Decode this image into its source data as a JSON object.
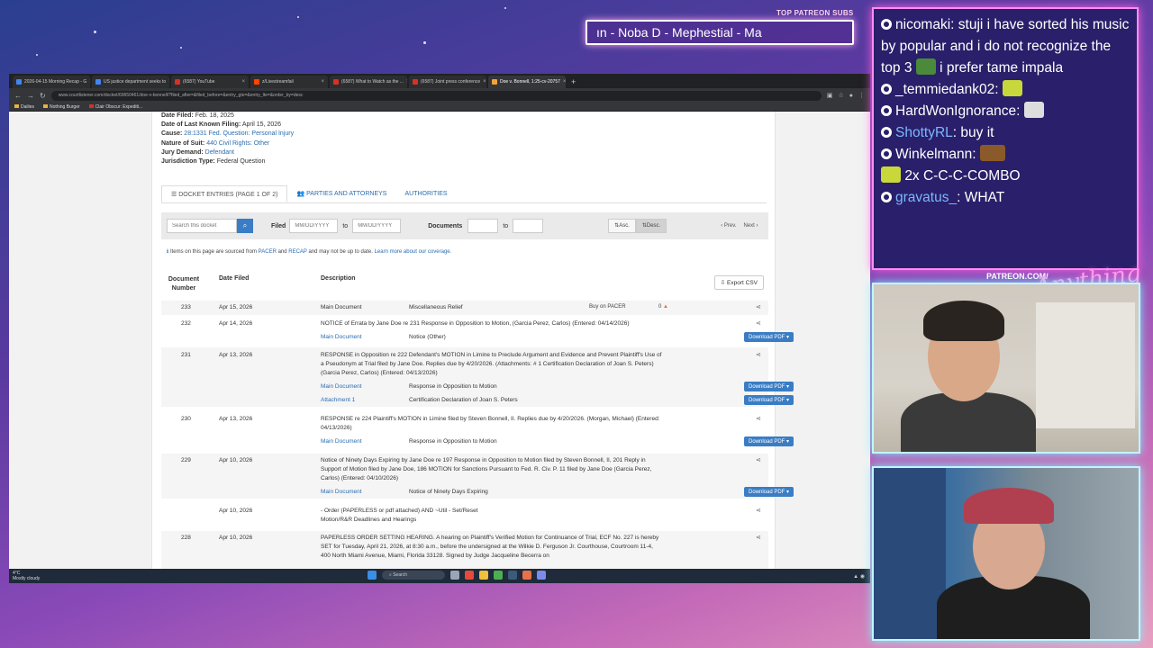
{
  "overlay": {
    "subs_title": "TOP PATREON SUBS",
    "subs_ticker": "ın -  Noba D - Mephestial - Ma",
    "patreon_url": "PATREON.COM/",
    "logo_text": "Anything Else?"
  },
  "browser": {
    "tabs": [
      {
        "label": "2026-04-15 Morning Recap - G"
      },
      {
        "label": "US justice department seeks to"
      },
      {
        "label": "(6587) YouTube"
      },
      {
        "label": "z/Livestreamfail"
      },
      {
        "label": "(6587) What to Watch as the ..."
      },
      {
        "label": "(6587) Joint press conference"
      },
      {
        "label": "Doe v. Bonnell, 1:25-cv-20757"
      }
    ],
    "url": "www.courtlistener.com/docket/69650461/doe-v-bonnell/?filed_after=&filed_before=&entry_gte=&entry_lte=&order_by=desc",
    "bookmarks": [
      "Dailies",
      "Nothing Burger",
      "Clair Obscur: Expediti..."
    ]
  },
  "case": {
    "date_filed_label": "Date Filed:",
    "date_filed": "Feb. 18, 2025",
    "last_filing_label": "Date of Last Known Filing:",
    "last_filing": "April 15, 2026",
    "cause_label": "Cause:",
    "cause": "28:1331 Fed. Question: Personal Injury",
    "nature_label": "Nature of Suit:",
    "nature": "440 Civil Rights: Other",
    "jury_label": "Jury Demand:",
    "jury": "Defendant",
    "jurisdiction_label": "Jurisdiction Type:",
    "jurisdiction": "Federal Question"
  },
  "subtabs": {
    "docket": "DOCKET ENTRIES (PAGE 1 OF 2)",
    "parties": "PARTIES AND ATTORNEYS",
    "authorities": "AUTHORITIES"
  },
  "filters": {
    "search_placeholder": "Search this docket",
    "filed_label": "Filed",
    "date_placeholder": "MM/DD/YYYY",
    "to_label": "to",
    "documents_label": "Documents",
    "asc": "Asc.",
    "desc": "Desc.",
    "prev": "‹ Prev.",
    "next": "Next ›"
  },
  "notice": {
    "pre": "Items on this page are sourced from ",
    "pacer": "PACER",
    "and": " and ",
    "recap": "RECAP",
    "mid": " and may not be up to date. ",
    "learn": "Learn more about our coverage."
  },
  "table": {
    "col_number": "Document Number",
    "col_date": "Date Filed",
    "col_desc": "Description",
    "export": "Export CSV",
    "rows": [
      {
        "num": "233",
        "date": "Apr 15, 2026",
        "desc": "",
        "subs": [
          {
            "link": "Main Document",
            "type": "Miscellaneous Relief"
          }
        ],
        "pacer": "Buy on PACER",
        "count": "0"
      },
      {
        "num": "232",
        "date": "Apr 14, 2026",
        "desc": "NOTICE of Errata by Jane Doe re 231 Response in Opposition to Motion, (Garcia Perez, Carlos) (Entered: 04/14/2026)",
        "subs": [
          {
            "link": "Main Document",
            "type": "Notice (Other)",
            "dl": "Download PDF"
          }
        ]
      },
      {
        "num": "231",
        "date": "Apr 13, 2026",
        "desc": "RESPONSE in Opposition re 222 Defendant's MOTION in Limine to Preclude Argument and Evidence and Prevent Plaintiff's Use of a Pseudonym at Trial filed by Jane Doe. Replies due by 4/20/2026. (Attachments: # 1 Certification Declaration of Joan S. Peters)(Garcia Perez, Carlos) (Entered: 04/13/2026)",
        "subs": [
          {
            "link": "Main Document",
            "type": "Response in Opposition to Motion",
            "dl": "Download PDF"
          },
          {
            "link": "Attachment 1",
            "type": "Certification Declaration of Joan S. Peters",
            "dl": "Download PDF"
          }
        ]
      },
      {
        "num": "230",
        "date": "Apr 13, 2026",
        "desc": "RESPONSE re 224 Plaintiff's MOTION in Limine filed by Steven Bonnell, II. Replies due by 4/20/2026. (Morgan, Michael) (Entered: 04/13/2026)",
        "subs": [
          {
            "link": "Main Document",
            "type": "Response in Opposition to Motion",
            "dl": "Download PDF"
          }
        ]
      },
      {
        "num": "229",
        "date": "Apr 10, 2026",
        "desc": "Notice of Ninety Days Expiring by Jane Doe re 197 Response in Opposition to Motion filed by Steven Bonnell, II, 201 Reply in Support of Motion filed by Jane Doe, 186 MOTION for Sanctions Pursuant to Fed. R. Civ. P. 11 filed by Jane Doe (Garcia Perez, Carlos) (Entered: 04/10/2026)",
        "subs": [
          {
            "link": "Main Document",
            "type": "Notice of Ninety Days Expiring",
            "dl": "Download PDF"
          }
        ]
      },
      {
        "num": "",
        "date": "Apr 10, 2026",
        "desc": "- Order (PAPERLESS or pdf attached) AND ~Util - Set/Reset Motion/R&R Deadlines and Hearings",
        "subs": []
      },
      {
        "num": "228",
        "date": "Apr 10, 2026",
        "desc": "PAPERLESS ORDER SETTING HEARING. A hearing on Plaintiff's Verified Motion for Continuance of Trial, ECF No. 227 is hereby SET for Tuesday, April 21, 2026, at 8:30 a.m., before the undersigned at the Wilkie D. Ferguson Jr. Courthouse, Courtroom 11-4, 400 North Miami Avenue, Miami, Florida 33128. Signed by Judge Jacqueline Becerra on",
        "subs": []
      }
    ]
  },
  "taskbar": {
    "temp": "4°C",
    "weather": "Mostly cloudy",
    "search": "Search"
  },
  "chat": {
    "messages": [
      {
        "user": "nicomaki",
        "text": "stuji i have sorted his music by popular and i do not recognize the top 3",
        "text2": "i prefer tame impala",
        "color": "#ffffff"
      },
      {
        "user": "_temmiedank02",
        "text": "",
        "color": "#ffffff"
      },
      {
        "user": "HardWonIgnorance",
        "text": "",
        "color": "#ffffff"
      },
      {
        "user": "ShottyRL",
        "text": "buy it",
        "color": "#7ab8ff"
      },
      {
        "user": "Winkelmann",
        "text": "",
        "color": "#ffffff"
      },
      {
        "user": "",
        "text": "2x C-C-C-COMBO",
        "color": "#ffffff"
      },
      {
        "user": "gravatus_",
        "text": "WHAT",
        "color": "#7ab8ff"
      }
    ]
  }
}
